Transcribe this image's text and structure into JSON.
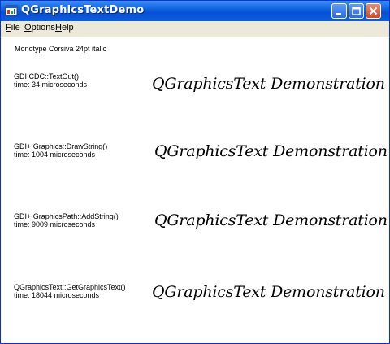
{
  "window": {
    "title": "QGraphicsTextDemo"
  },
  "menu": {
    "file": "File",
    "options": "Options",
    "help": "Help"
  },
  "font_info": "Monotype Corsiva 24pt italic",
  "demo_text": "QGraphicsText Demonstration",
  "rows": [
    {
      "method": "GDI  CDC::TextOut()",
      "time": "time: 34 microseconds"
    },
    {
      "method": "GDI+ Graphics::DrawString()",
      "time": "time: 1004 microseconds"
    },
    {
      "method": "GDI+ GraphicsPath::AddString()",
      "time": "time: 9009 microseconds"
    },
    {
      "method": "QGraphicsText::GetGraphicsText()",
      "time": "time: 18044 microseconds"
    }
  ],
  "icons": {
    "app": "app-icon",
    "minimize": "minimize-icon",
    "maximize": "maximize-icon",
    "close": "close-icon"
  },
  "colors": {
    "titlebar": "#0a5fdd",
    "close_button": "#cf4a2a",
    "menubar": "#ece9d8"
  }
}
